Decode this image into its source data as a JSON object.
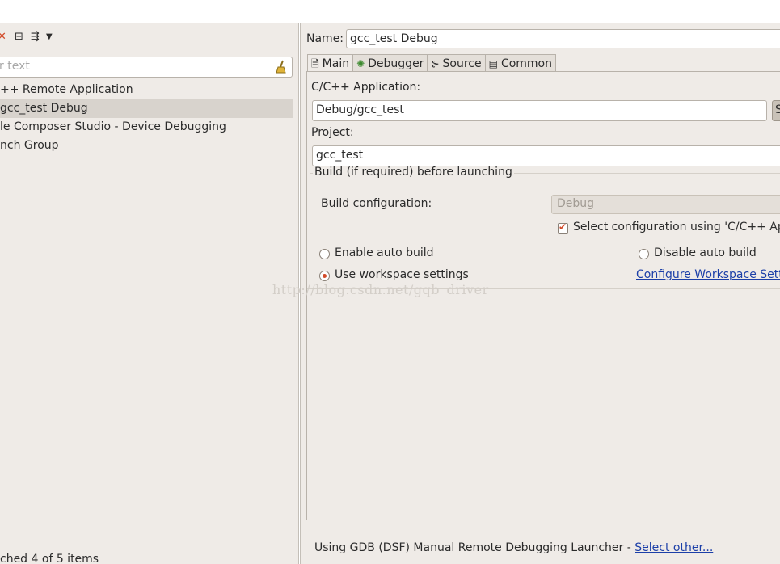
{
  "left": {
    "filter_placeholder": "r text",
    "tree_items": [
      "++ Remote Application",
      "gcc_test Debug",
      "le Composer Studio - Device Debugging",
      "nch Group"
    ],
    "status": "ched 4 of 5 items"
  },
  "right": {
    "name_label": "Name:",
    "name_value": "gcc_test Debug",
    "tabs": [
      {
        "label": "Main",
        "icon": "page-icon"
      },
      {
        "label": "Debugger",
        "icon": "bug-icon"
      },
      {
        "label": "Source",
        "icon": "source-icon"
      },
      {
        "label": "Common",
        "icon": "common-icon"
      }
    ],
    "app_label": "C/C++ Application:",
    "app_value": "Debug/gcc_test",
    "search_btn": "S",
    "project_label": "Project:",
    "project_value": "gcc_test",
    "build_group_title": "Build (if required) before launching",
    "build_config_label": "Build configuration:",
    "build_config_value": "Debug",
    "select_config_label": "Select configuration using 'C/C++ Appli",
    "enable_auto_build": "Enable auto build",
    "disable_auto_build": "Disable auto build",
    "use_workspace": "Use workspace settings",
    "configure_link": "Configure Workspace Settin",
    "launcher_text": "Using GDB (DSF) Manual Remote Debugging Launcher - ",
    "select_other": "Select other..."
  },
  "watermark": "http://blog.csdn.net/gqb_driver",
  "colors": {
    "accent": "#d24b2a",
    "link": "#1c3fa8",
    "panel": "#efebe7"
  }
}
